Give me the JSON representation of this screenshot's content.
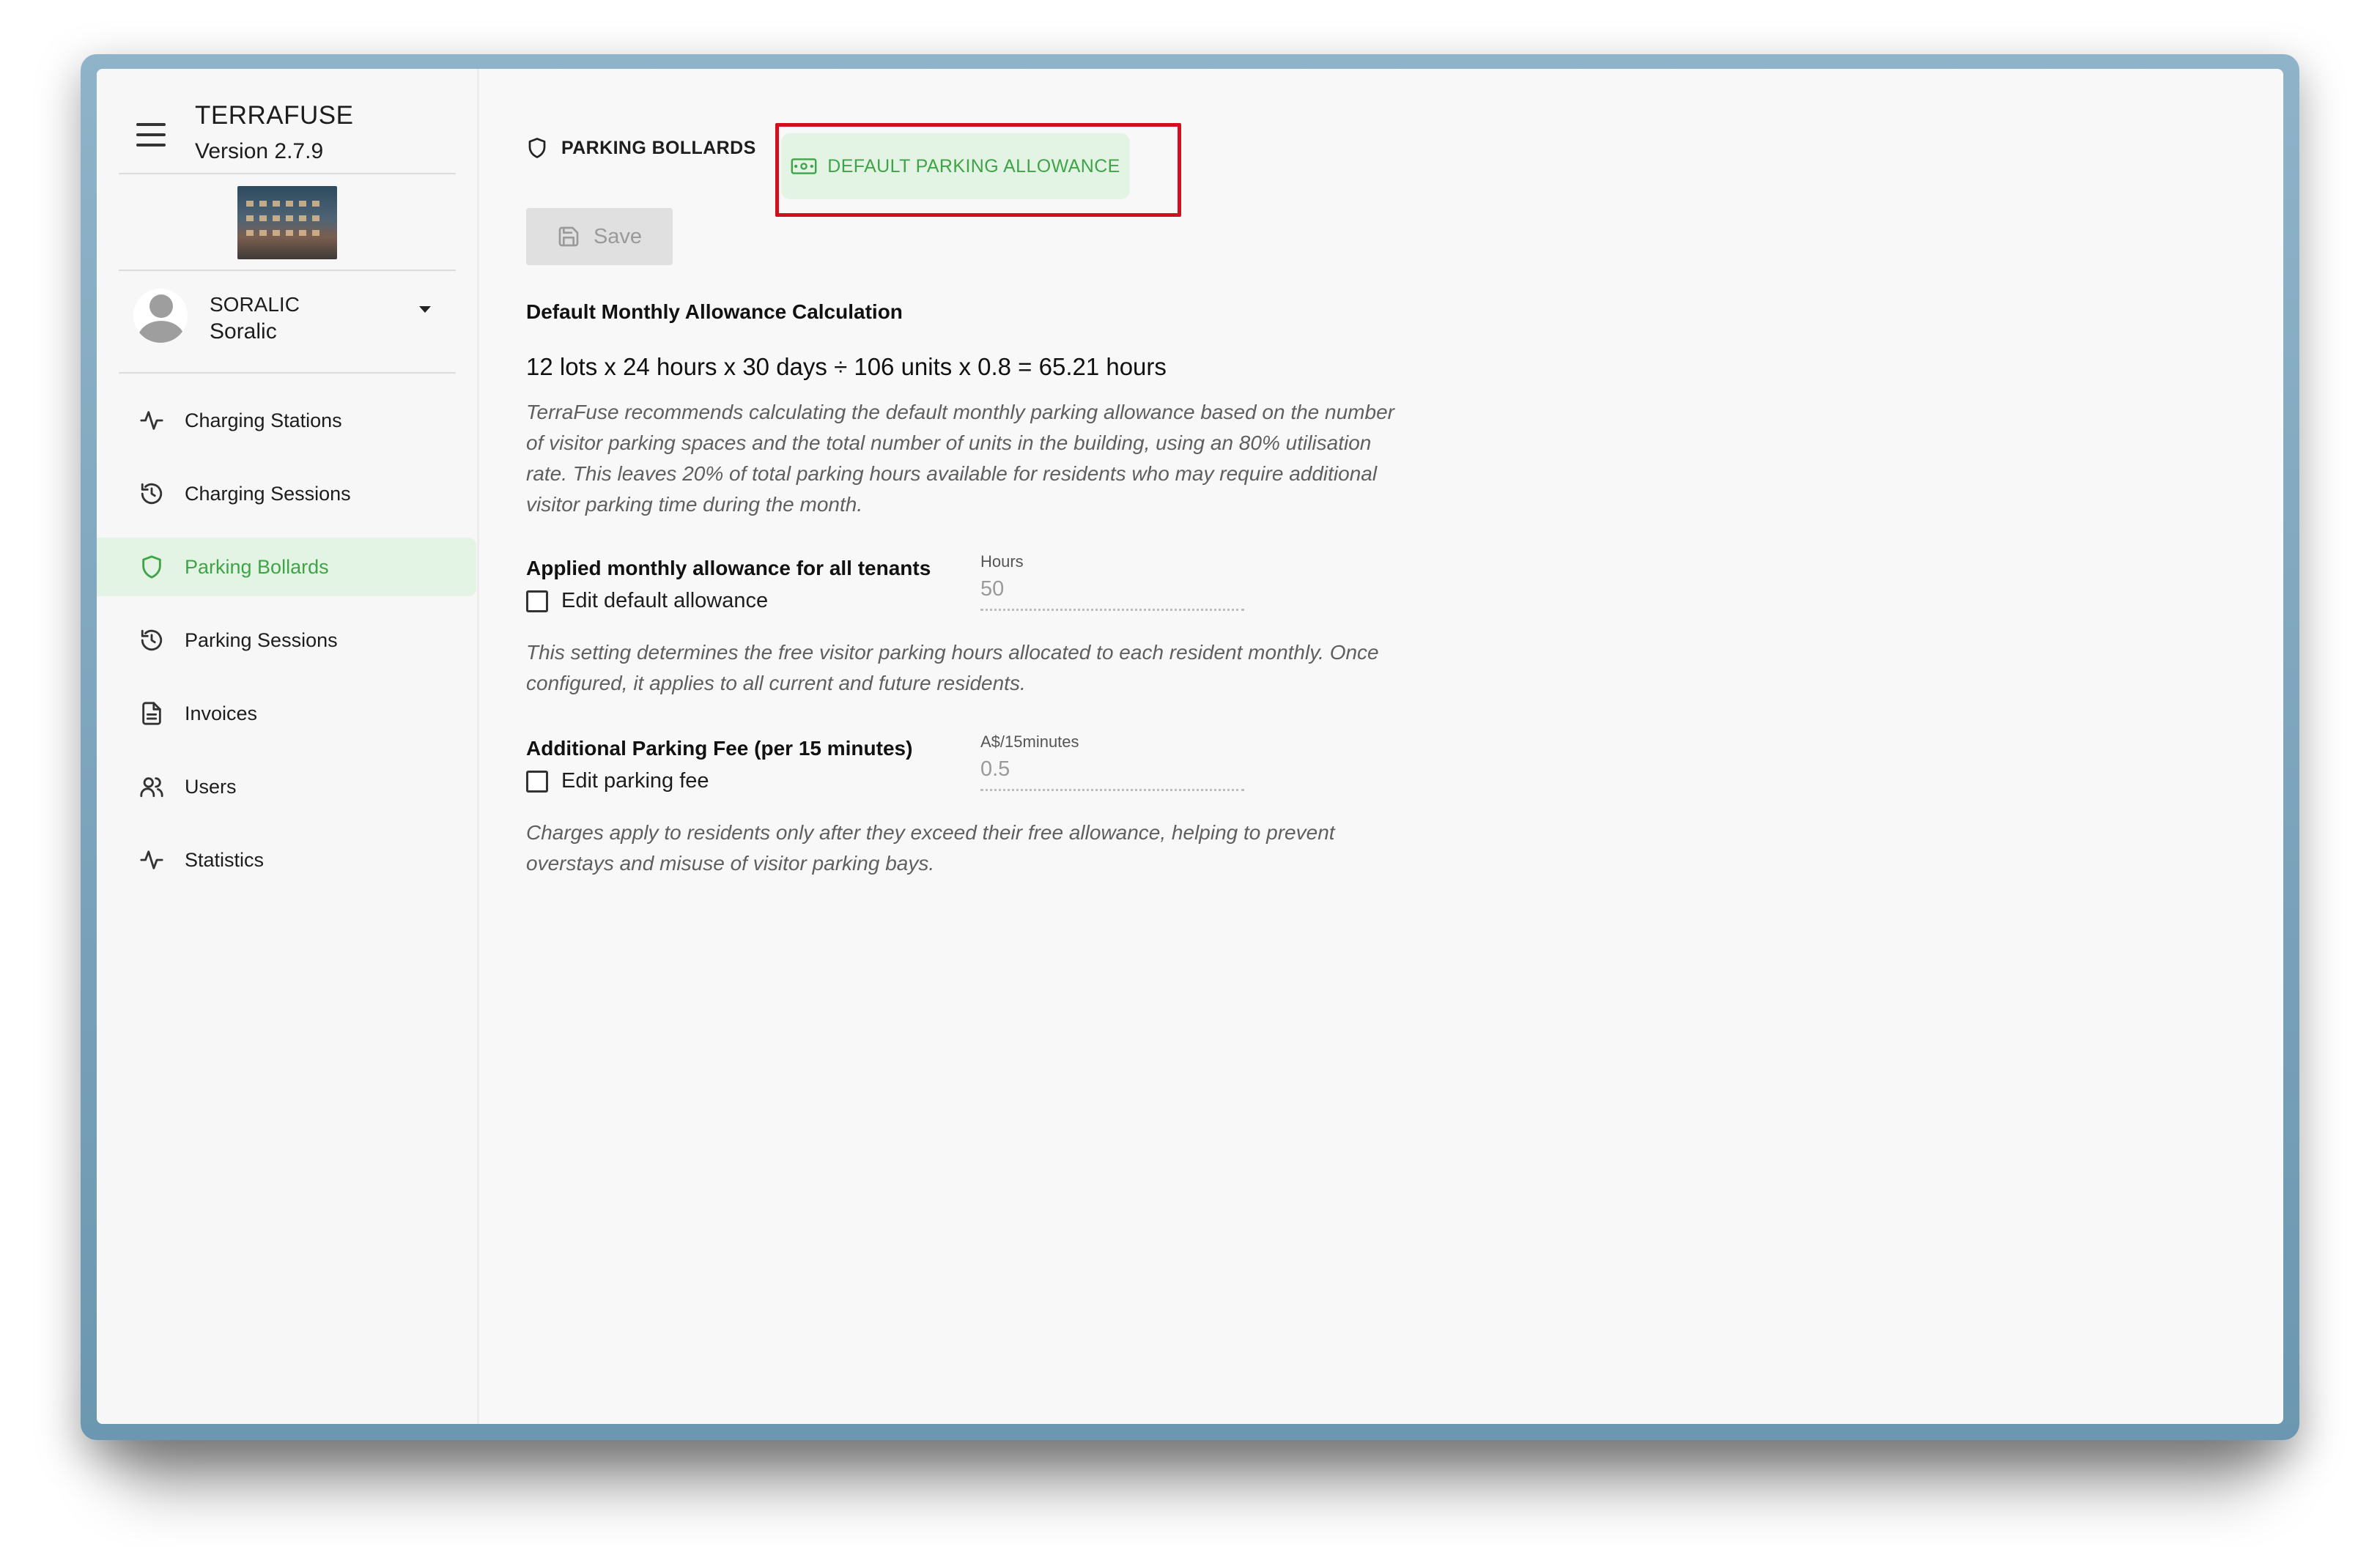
{
  "app": {
    "title": "TERRAFUSE",
    "version": "Version 2.7.9"
  },
  "user": {
    "org": "SORALIC",
    "name": "Soralic"
  },
  "sidebar": {
    "items": [
      {
        "label": "Charging Stations",
        "icon": "activity-icon"
      },
      {
        "label": "Charging Sessions",
        "icon": "history-icon"
      },
      {
        "label": "Parking Bollards",
        "icon": "shield-icon",
        "active": true
      },
      {
        "label": "Parking Sessions",
        "icon": "history-icon"
      },
      {
        "label": "Invoices",
        "icon": "document-icon"
      },
      {
        "label": "Users",
        "icon": "users-icon"
      },
      {
        "label": "Statistics",
        "icon": "activity-icon"
      }
    ]
  },
  "tabs": {
    "bollards": "PARKING BOLLARDS",
    "allowance": "DEFAULT PARKING ALLOWANCE",
    "active": "allowance"
  },
  "toolbar": {
    "save_label": "Save"
  },
  "calculation": {
    "title": "Default Monthly Allowance Calculation",
    "formula": "12 lots x 24 hours x 30 days ÷ 106 units x 0.8 = 65.21 hours",
    "note": "TerraFuse recommends calculating the default monthly parking allowance based on the number of visitor parking spaces and the total number of units in the building, using an 80% utilisation rate. This leaves 20% of total parking hours available for residents who may require additional visitor parking time during the month."
  },
  "allowance": {
    "title": "Applied monthly allowance for all tenants",
    "checkbox_label": "Edit default allowance",
    "field_label": "Hours",
    "field_value": "50",
    "note": "This setting determines the free visitor parking hours allocated to each resident monthly. Once configured, it applies to all current and future residents."
  },
  "fee": {
    "title": "Additional Parking Fee (per 15 minutes)",
    "checkbox_label": "Edit parking fee",
    "field_label": "A$/15minutes",
    "field_value": "0.5",
    "note": "Charges apply to residents only after they exceed their free allowance, helping to prevent overstays and misuse of visitor parking bays."
  },
  "colors": {
    "accent": "#3fa447",
    "accent_bg": "#e3f4e4",
    "highlight": "#d0101c"
  }
}
